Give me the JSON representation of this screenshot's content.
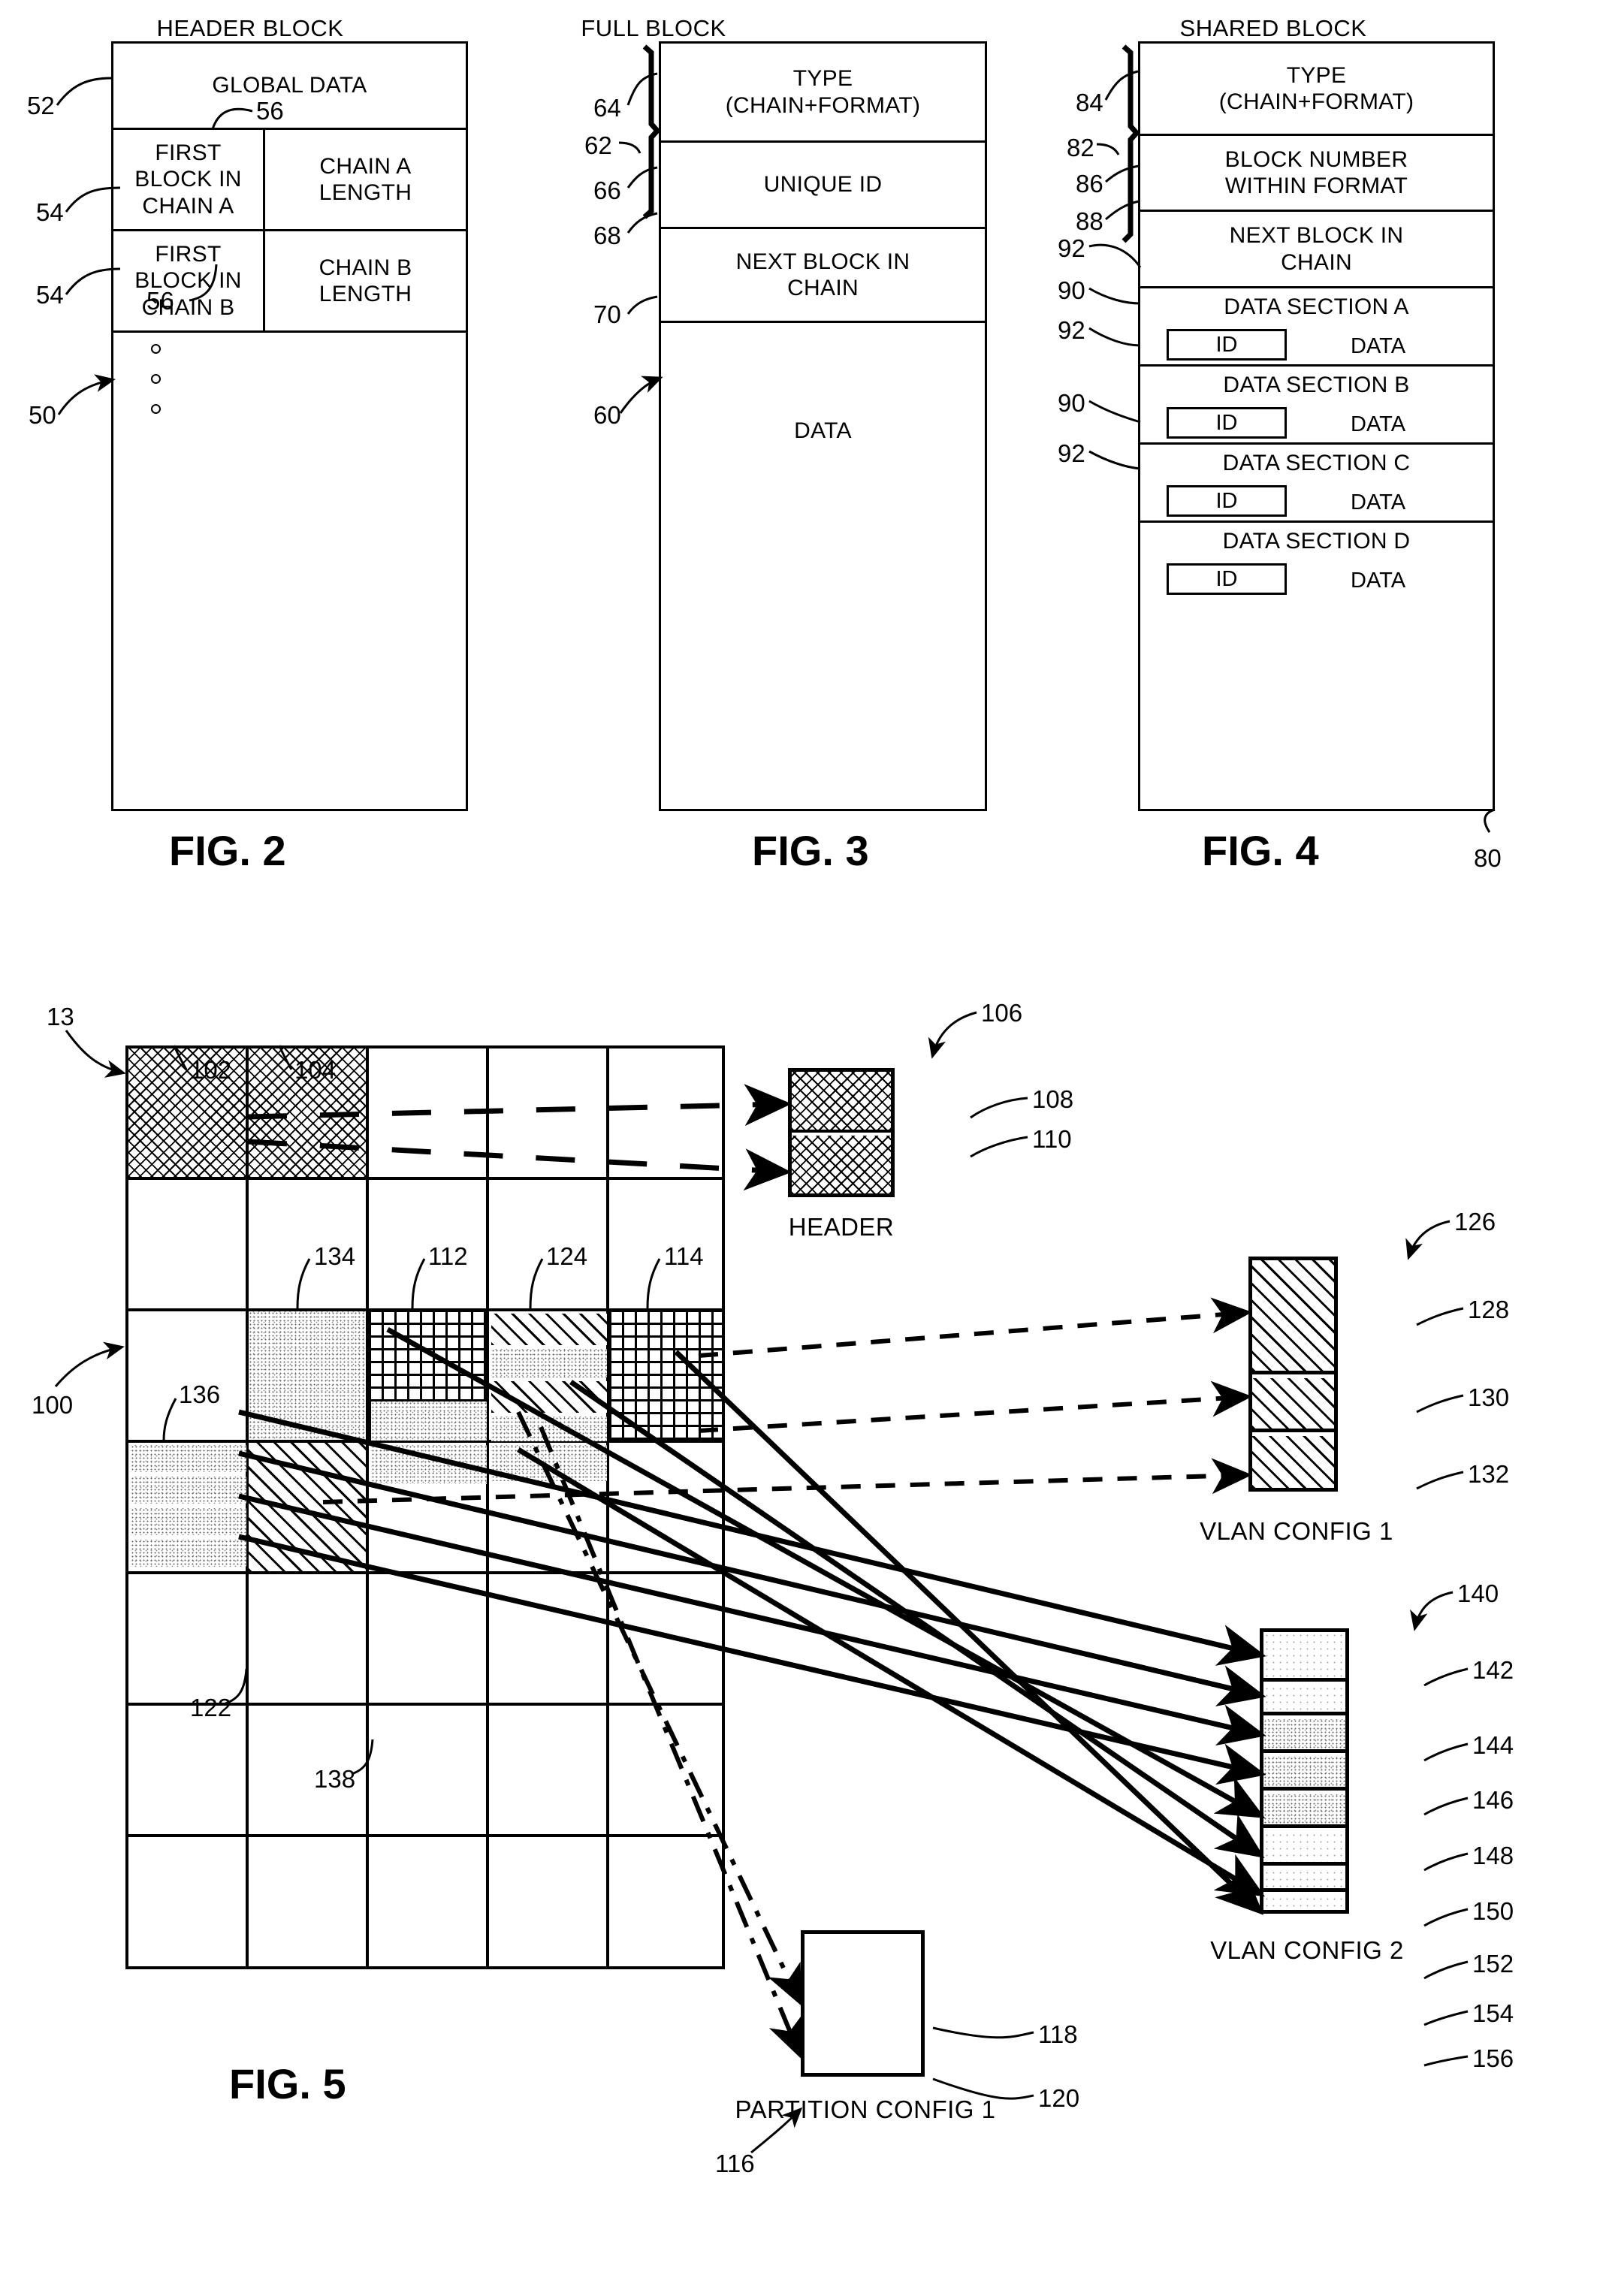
{
  "figures": [
    {
      "id": "fig2",
      "caption": "FIG. 2",
      "title": "HEADER BLOCK",
      "rows": [
        {
          "label": "GLOBAL DATA"
        },
        {
          "left": "FIRST BLOCK IN CHAIN A",
          "right": "CHAIN A LENGTH"
        },
        {
          "left": "FIRST BLOCK IN CHAIN B",
          "right": "CHAIN B LENGTH"
        }
      ],
      "refs": [
        "52",
        "54",
        "54",
        "56",
        "56",
        "50"
      ]
    },
    {
      "id": "fig3",
      "caption": "FIG. 3",
      "title": "FULL BLOCK",
      "rows": [
        {
          "label": "TYPE (CHAIN+FORMAT)"
        },
        {
          "label": "UNIQUE ID"
        },
        {
          "label": "NEXT BLOCK IN CHAIN"
        },
        {
          "label": "DATA"
        }
      ],
      "refs": [
        "64",
        "62",
        "66",
        "68",
        "70",
        "60"
      ]
    },
    {
      "id": "fig4",
      "caption": "FIG. 4",
      "title": "SHARED BLOCK",
      "rows": [
        {
          "label": "TYPE (CHAIN+FORMAT)"
        },
        {
          "label": "BLOCK NUMBER WITHIN FORMAT"
        },
        {
          "label": "NEXT BLOCK IN CHAIN"
        },
        {
          "label": "DATA SECTION A",
          "id": "ID",
          "data": "DATA"
        },
        {
          "label": "DATA SECTION B",
          "id": "ID",
          "data": "DATA"
        },
        {
          "label": "DATA SECTION C",
          "id": "ID",
          "data": "DATA"
        },
        {
          "label": "DATA SECTION D",
          "id": "ID",
          "data": "DATA"
        }
      ],
      "refs": [
        "84",
        "82",
        "86",
        "88",
        "92",
        "90",
        "92",
        "90",
        "92",
        "80"
      ]
    },
    {
      "id": "fig5",
      "caption": "FIG. 5",
      "refs": [
        "13",
        "100",
        "102",
        "104",
        "134",
        "112",
        "124",
        "114",
        "136",
        "122",
        "138"
      ]
    }
  ],
  "fig2": {
    "title": "HEADER BLOCK",
    "caption": "FIG. 2",
    "global_data": "GLOBAL DATA",
    "first_block_chain_a": "FIRST BLOCK IN CHAIN A",
    "chain_a_length": "CHAIN A LENGTH",
    "first_block_chain_b": "FIRST BLOCK IN CHAIN B",
    "chain_b_length": "CHAIN B LENGTH",
    "ref_52": "52",
    "ref_54a": "54",
    "ref_54b": "54",
    "ref_56a": "56",
    "ref_56b": "56",
    "ref_50": "50"
  },
  "fig3": {
    "title": "FULL BLOCK",
    "caption": "FIG. 3",
    "type": "TYPE\n(CHAIN+FORMAT)",
    "type_line1": "TYPE",
    "type_line2": "(CHAIN+FORMAT)",
    "unique_id": "UNIQUE ID",
    "next_block_line1": "NEXT BLOCK IN",
    "next_block_line2": "CHAIN",
    "data": "DATA",
    "ref_64": "64",
    "ref_62": "62",
    "ref_66": "66",
    "ref_68": "68",
    "ref_70": "70",
    "ref_60": "60"
  },
  "fig4": {
    "title": "SHARED BLOCK",
    "caption": "FIG. 4",
    "type_line1": "TYPE",
    "type_line2": "(CHAIN+FORMAT)",
    "block_number_line1": "BLOCK NUMBER",
    "block_number_line2": "WITHIN FORMAT",
    "next_block_line1": "NEXT BLOCK IN",
    "next_block_line2": "CHAIN",
    "section_a": "DATA SECTION A",
    "section_b": "DATA SECTION B",
    "section_c": "DATA SECTION C",
    "section_d": "DATA SECTION D",
    "id_label": "ID",
    "data_label": "DATA",
    "ref_84": "84",
    "ref_82": "82",
    "ref_86": "86",
    "ref_88": "88",
    "ref_92a": "92",
    "ref_90a": "90",
    "ref_92b": "92",
    "ref_90b": "90",
    "ref_92c": "92",
    "ref_80": "80"
  },
  "fig5": {
    "caption": "FIG. 5",
    "header_label": "HEADER",
    "vlan_config_1_label": "VLAN CONFIG 1",
    "vlan_config_2_label": "VLAN CONFIG 2",
    "partition_config_1_label": "PARTITION CONFIG 1",
    "ref_13": "13",
    "ref_100": "100",
    "ref_102": "102",
    "ref_104": "104",
    "ref_134": "134",
    "ref_112": "112",
    "ref_124": "124",
    "ref_114": "114",
    "ref_136": "136",
    "ref_122": "122",
    "ref_138": "138",
    "ref_106": "106",
    "ref_108": "108",
    "ref_110": "110",
    "ref_116": "116",
    "ref_118": "118",
    "ref_120": "120",
    "ref_126": "126",
    "ref_128": "128",
    "ref_130": "130",
    "ref_132": "132",
    "ref_140": "140",
    "ref_142": "142",
    "ref_144": "144",
    "ref_146": "146",
    "ref_148": "148",
    "ref_150": "150",
    "ref_152": "152",
    "ref_154": "154",
    "ref_156": "156"
  }
}
